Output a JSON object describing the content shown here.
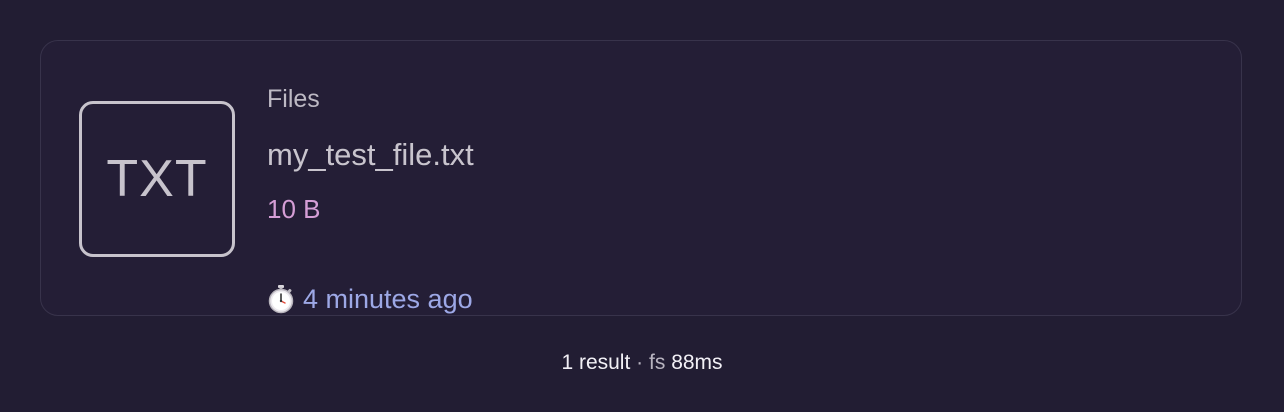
{
  "result": {
    "icon_label": "TXT",
    "category": "Files",
    "filename": "my_test_file.txt",
    "size": "10 B",
    "time_icon": "stopwatch-icon",
    "modified": "4 minutes ago"
  },
  "footer": {
    "count": "1 result",
    "separator": "·",
    "source": "fs",
    "duration": "88ms"
  },
  "colors": {
    "background": "#221d33",
    "size_text": "#d59ed6",
    "time_text": "#9da8e6"
  }
}
